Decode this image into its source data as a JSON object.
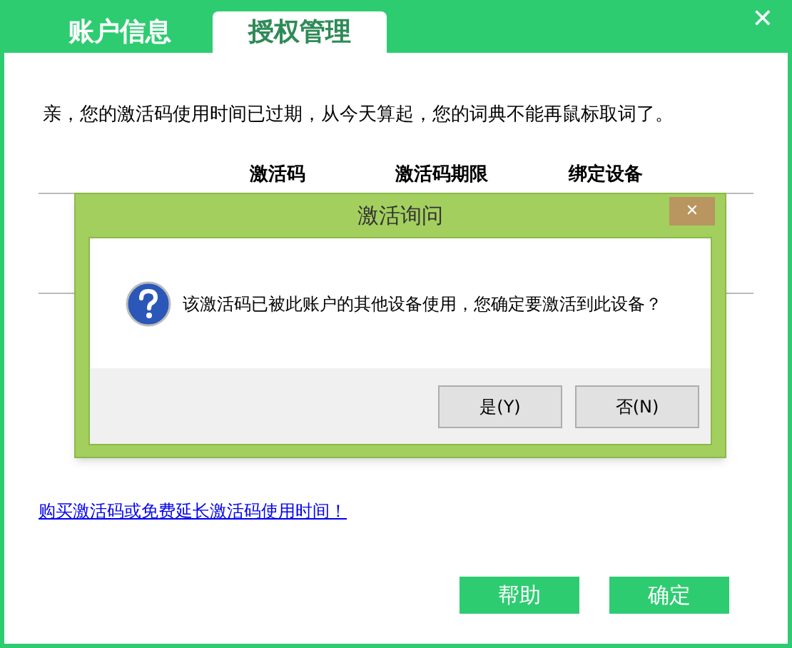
{
  "tabs": [
    {
      "label": "账户信息",
      "selected": false
    },
    {
      "label": "授权管理",
      "selected": true
    }
  ],
  "close_glyph": "✕",
  "message": "亲，您的激活码使用时间已过期，从今天算起，您的词典不能再鼠标取词了。",
  "table": {
    "columns": [
      "激活码",
      "激活码期限",
      "绑定设备"
    ]
  },
  "link": "购买激活码或免费延长激活码使用时间！",
  "buttons": [
    "帮助",
    "确定"
  ],
  "dialog": {
    "title": "激活询问",
    "close_glyph": "✕",
    "message": "该激活码已被此账户的其他设备使用，您确定要激活到此设备？",
    "buttons": [
      "是(Y)",
      "否(N)"
    ]
  }
}
